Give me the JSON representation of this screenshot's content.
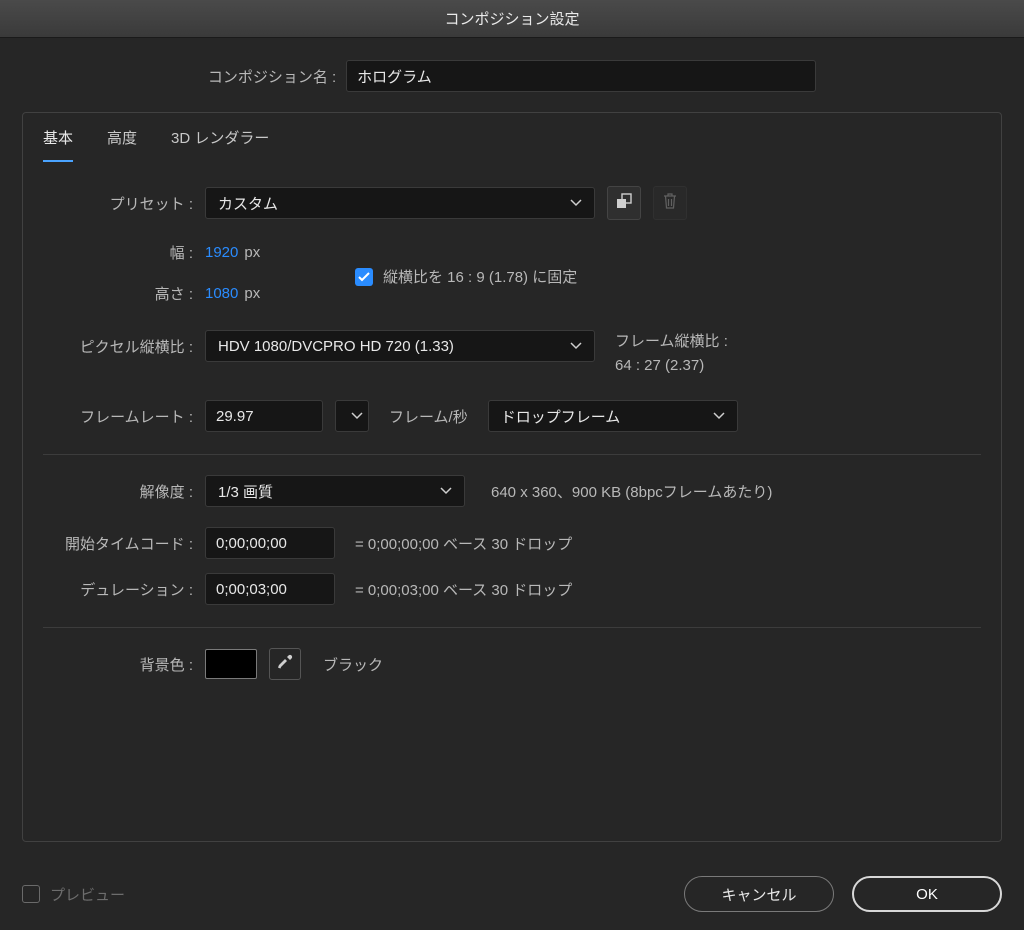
{
  "title": "コンポジション設定",
  "comp_name": {
    "label": "コンポジション名 :",
    "value": "ホログラム"
  },
  "tabs": {
    "basic": "基本",
    "advanced": "高度",
    "renderer": "3D レンダラー"
  },
  "preset": {
    "label": "プリセット :",
    "value": "カスタム"
  },
  "width": {
    "label": "幅 :",
    "value": "1920",
    "unit": "px"
  },
  "height": {
    "label": "高さ :",
    "value": "1080",
    "unit": "px"
  },
  "lock_aspect": {
    "checked": true,
    "label": "縦横比を 16 : 9 (1.78) に固定"
  },
  "pixel_aspect": {
    "label": "ピクセル縦横比 :",
    "value": "HDV 1080/DVCPRO HD 720 (1.33)"
  },
  "frame_aspect": {
    "label": "フレーム縦横比 :",
    "value": "64 : 27 (2.37)"
  },
  "framerate": {
    "label": "フレームレート :",
    "value": "29.97",
    "unit_label": "フレーム/秒",
    "drop": "ドロップフレーム"
  },
  "resolution": {
    "label": "解像度 :",
    "value": "1/3 画質",
    "info": "640 x 360、900 KB (8bpcフレームあたり)"
  },
  "start_tc": {
    "label": "開始タイムコード :",
    "value": "0;00;00;00",
    "info": "= 0;00;00;00  ベース 30  ドロップ"
  },
  "duration": {
    "label": "デュレーション :",
    "value": "0;00;03;00",
    "info": "= 0;00;03;00  ベース 30  ドロップ"
  },
  "bgcolor": {
    "label": "背景色 :",
    "name": "ブラック",
    "hex": "#000000"
  },
  "footer": {
    "preview": "プレビュー",
    "cancel": "キャンセル",
    "ok": "OK"
  }
}
